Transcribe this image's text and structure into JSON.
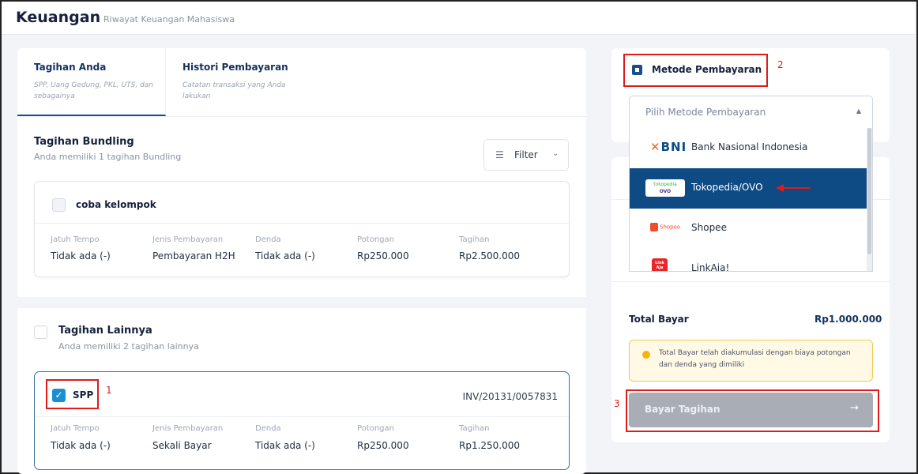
{
  "header": {
    "title": "Keuangan",
    "subtitle": "Riwayat Keuangan Mahasiswa"
  },
  "tabs": [
    {
      "label": "Tagihan Anda",
      "desc": "SPP, Uang Gedung, PKL, UTS, dan sebagainya",
      "active": true
    },
    {
      "label": "Histori Pembayaran",
      "desc": "Catatan transaksi yang Anda lakukan",
      "active": false
    }
  ],
  "bundling": {
    "title": "Tagihan Bundling",
    "subtitle": "Anda memiliki 1 tagihan Bundling",
    "filter_label": "Filter"
  },
  "columns": [
    "Jatuh Tempo",
    "Jenis Pembayaran",
    "Denda",
    "Potongan",
    "Tagihan"
  ],
  "bundle_card": {
    "name": "coba kelompok",
    "values": [
      "Tidak ada (-)",
      "Pembayaran H2H",
      "Tidak ada (-)",
      "Rp250.000",
      "Rp2.500.000"
    ]
  },
  "lainnya": {
    "title": "Tagihan Lainnya",
    "subtitle": "Anda memiliki 2 tagihan lainnya"
  },
  "spp_card": {
    "name": "SPP",
    "invoice": "INV/20131/0057831",
    "values": [
      "Tidak ada (-)",
      "Sekali Bayar",
      "Tidak ada (-)",
      "Rp250.000",
      "Rp1.250.000"
    ]
  },
  "payment": {
    "title": "Metode Pembayaran",
    "placeholder": "Pilih Metode Pembayaran",
    "options": [
      {
        "label": "Bank Nasional Indonesia",
        "logo": "BNI"
      },
      {
        "label": "Tokopedia/OVO",
        "logo_top": "tokopedia",
        "logo_bottom": "OVO"
      },
      {
        "label": "Shopee",
        "logo": "Shopee"
      },
      {
        "label": "LinkAja!",
        "logo": "Link Aja"
      }
    ]
  },
  "total": {
    "label": "Total Bayar",
    "value": "Rp1.000.000"
  },
  "info": "Total Bayar telah diakumulasi dengan biaya potongan dan denda yang dimiliki",
  "pay_button": {
    "label": "Bayar Tagihan",
    "arrow": "→"
  },
  "annotations": [
    "1",
    "2",
    "3"
  ]
}
